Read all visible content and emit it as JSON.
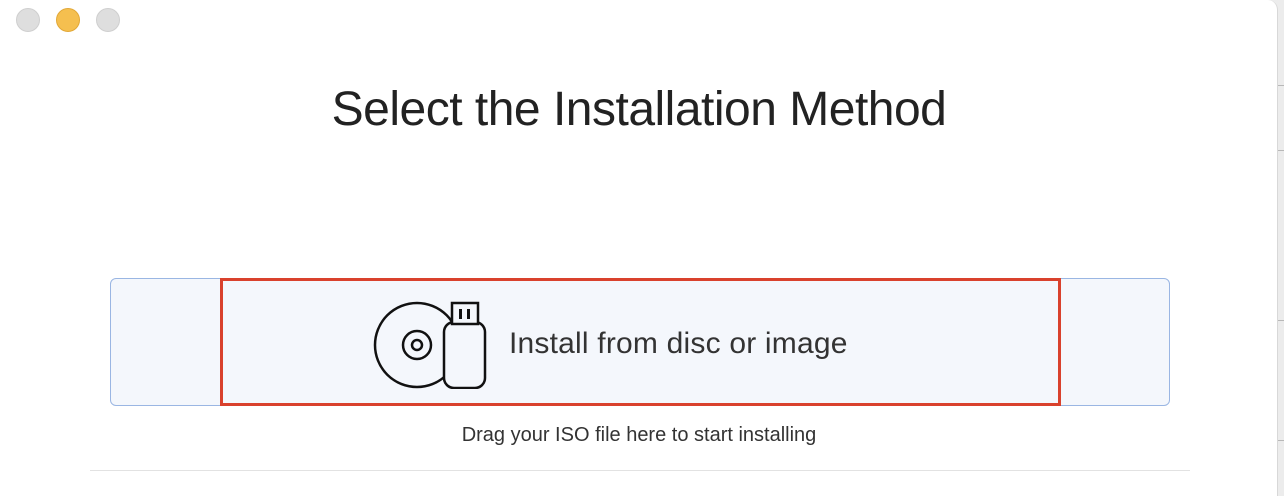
{
  "window": {
    "controls": [
      "close",
      "minimize",
      "zoom"
    ]
  },
  "header": {
    "title": "Select the Installation Method"
  },
  "install_option": {
    "label": "Install from disc or image",
    "icon": "disc-usb-icon"
  },
  "drop_zone": {
    "hint": "Drag your ISO file here to start installing"
  },
  "colors": {
    "selection_border": "#d9412d",
    "drop_zone_background": "#f4f7fc",
    "drop_zone_border": "#9ab6e3",
    "minimize_button": "#f5bf4f"
  }
}
